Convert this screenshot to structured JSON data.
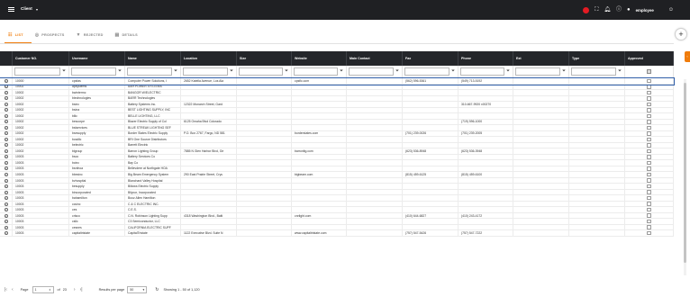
{
  "topbar": {
    "client_label": "Client",
    "user_label": "employee",
    "icons": [
      "menu-icon",
      "chevron-down-icon",
      "status-red-dot",
      "fullscreen-icon",
      "bell-icon",
      "help-icon",
      "user-icon",
      "chat-icon"
    ]
  },
  "tabs": [
    {
      "label": "LIST",
      "icon": "list-icon",
      "active": true
    },
    {
      "label": "PROSPECTS",
      "icon": "target-icon",
      "active": false
    },
    {
      "label": "REJECTED",
      "icon": "thumbs-down-icon",
      "active": false
    },
    {
      "label": "DETAILS",
      "icon": "document-icon",
      "active": false
    }
  ],
  "table": {
    "columns": [
      "",
      "Customer NO.",
      "Username",
      "Name",
      "Location",
      "Size",
      "Website",
      "Main Contact",
      "Fax",
      "Phone",
      "Ext",
      "Type",
      "Approved"
    ],
    "rows": [
      [
        "10000",
        "cpsfas",
        "Computer Power Solutions, I",
        "2652 Katella Avenue, Los Ala",
        "",
        "cpsflc.com",
        "",
        "(562) 596-5361",
        "(549) 713-5192",
        "",
        ""
      ],
      [
        "10002",
        "apsystems",
        "AAH POWER SYSTEMS",
        "",
        "",
        "",
        "",
        "",
        "",
        "",
        ""
      ],
      [
        "10002",
        "bwintermc",
        "BANGOR W/ELECTRIC",
        "",
        "",
        "",
        "",
        "",
        "",
        "",
        ""
      ],
      [
        "10002",
        "btechnologies",
        "BARR Technologies",
        "",
        "",
        "",
        "",
        "",
        "",
        "",
        ""
      ],
      [
        "10002",
        "bsinc",
        "Battery Systems Inc.",
        "12322 Monarch Street, Gard",
        "",
        "",
        "",
        "",
        "310-667-9920 x00270",
        "",
        ""
      ],
      [
        "10002",
        "bsina",
        "BEST LIGHTING SUPPLY, INC",
        "",
        "",
        "",
        "",
        "",
        "",
        "",
        ""
      ],
      [
        "10002",
        "bllic",
        "BELLE LIGHTING, LLC",
        "",
        "",
        "",
        "",
        "",
        "",
        "",
        ""
      ],
      [
        "10002",
        "bescorpe",
        "Blazer Electric Supply of Col",
        "6125 Omaha Blvd Colorado",
        "",
        "",
        "",
        "",
        "(719) 596-1000",
        "",
        ""
      ],
      [
        "10002",
        "bslservices",
        "BLUE STREAK LIGHTING SEF",
        "",
        "",
        "",
        "",
        "",
        "",
        "",
        ""
      ],
      [
        "10002",
        "bsesupply",
        "Border States Electric Supply",
        "P.O. Box 2767, Fargo, ND 581",
        "",
        "borderstates.com",
        "",
        "(701) 239-0026",
        "(701) 239-2005",
        "",
        ""
      ],
      [
        "10002",
        "bcsdllc",
        "BRI One Source Distributors",
        "",
        "",
        "",
        "",
        "",
        "",
        "",
        ""
      ],
      [
        "10002",
        "belectric",
        "Barrett Electric",
        "",
        "",
        "",
        "",
        "",
        "",
        "",
        ""
      ],
      [
        "10002",
        "blgroup",
        "Barron Lighting Group",
        "7885 N Glen Harbor Blvd, Ge",
        "",
        "barronltg.com",
        "",
        "(623) 536-8948",
        "(623) 536-3948",
        "",
        ""
      ],
      [
        "10003",
        "bsco",
        "Battery Services Co",
        "",
        "",
        "",
        "",
        "",
        "",
        "",
        ""
      ],
      [
        "10003",
        "bcinc",
        "Bay Co",
        "",
        "",
        "",
        "",
        "",
        "",
        "",
        ""
      ],
      [
        "10003",
        "bsnfnoa",
        "Bellevdere at Northgate HOA",
        "",
        "",
        "",
        "",
        "",
        "",
        "",
        ""
      ],
      [
        "10003",
        "bbesinc",
        "Big Beam Emergency System",
        "290 East Prairie Street, Crys",
        "",
        "bigbeam.com",
        "",
        "(815) 459-6125",
        "(815) 459-6100",
        "",
        ""
      ],
      [
        "10003",
        "bvhospital",
        "Blanchard Valley Hospital",
        "",
        "",
        "",
        "",
        "",
        "",
        "",
        ""
      ],
      [
        "10003",
        "besupply",
        "Billows Electric Supply",
        "",
        "",
        "",
        "",
        "",
        "",
        "",
        ""
      ],
      [
        "10003",
        "bincorporated",
        "Bilycor, Incorporated",
        "",
        "",
        "",
        "",
        "",
        "",
        "",
        ""
      ],
      [
        "10003",
        "bahamilton",
        "Booz Allen Hamilton",
        "",
        "",
        "",
        "",
        "",
        "",
        "",
        ""
      ],
      [
        "10003",
        "ccsinc",
        "C & C ELECTRIC INC.",
        "",
        "",
        "",
        "",
        "",
        "",
        "",
        ""
      ],
      [
        "10003",
        "ces",
        "C.E.S.",
        "",
        "",
        "",
        "",
        "",
        "",
        "",
        ""
      ],
      [
        "10003",
        "crlsco",
        "C.N. Robinson Lighting Supp",
        "4318 Washington Blvd., Balti",
        "",
        "cnrlight.com",
        "",
        "(410) 644-6827",
        "(410) 243-4172",
        "",
        ""
      ],
      [
        "10003",
        "csllc",
        "C3 Semiconductor, LLC",
        "",
        "",
        "",
        "",
        "",
        "",
        "",
        ""
      ],
      [
        "10003",
        "cesnes",
        "CALIFORNIA ELECTRIC SUPF",
        "",
        "",
        "",
        "",
        "",
        "",
        "",
        ""
      ],
      [
        "10003",
        "capitaltristate",
        "CapitalTristate",
        "1122 Executive Blvd. Suite N",
        "",
        "www.capitaltristate.com",
        "",
        "(757) 547-5426",
        "(757) 547-7222",
        "",
        ""
      ]
    ]
  },
  "pager": {
    "page_label": "Page",
    "page_value": "1",
    "of_label": "of",
    "total_pages": "23",
    "per_page_label": "Results per page",
    "per_page_value": "50",
    "showing": "Showing 1 - 50 of 1,120"
  }
}
